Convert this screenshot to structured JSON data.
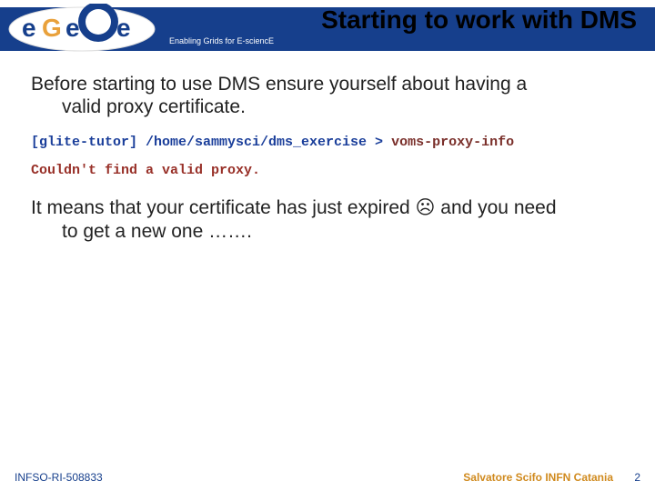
{
  "header": {
    "title": "Starting to work with DMS",
    "tagline": "Enabling Grids for E-sciencE",
    "logo_text": "eGee"
  },
  "body": {
    "intro_line1": "Before starting to use DMS ensure yourself about having a",
    "intro_line2": "valid proxy certificate.",
    "code_prefix": "[glite-tutor] /home/sammysci/dms_exercise > ",
    "code_cmd": "voms-proxy-info",
    "error_line": "Couldn't find a valid proxy.",
    "outro_line1": "It means that your certificate has just expired ☹ and you need",
    "outro_line2": "to get a new one ……."
  },
  "footer": {
    "left": "INFSO-RI-508833",
    "right": "Salvatore Scifo INFN Catania",
    "page": "2"
  }
}
